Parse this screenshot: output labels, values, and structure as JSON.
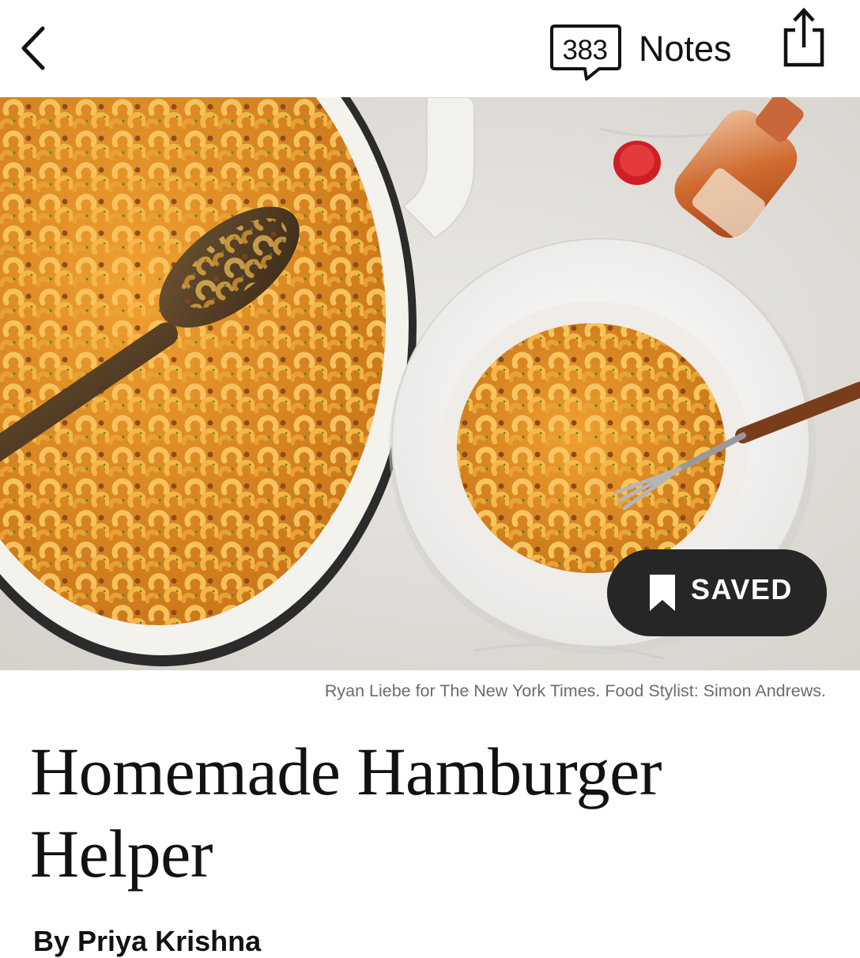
{
  "header": {
    "back_icon": "chevron-left-icon",
    "notes_count": "383",
    "notes_label": "Notes",
    "share_icon": "share-icon"
  },
  "hero": {
    "saved_label": "SAVED",
    "saved_icon": "bookmark-icon",
    "caption": "Ryan Liebe for The New York Times. Food Stylist: Simon Andrews."
  },
  "recipe": {
    "title": "Homemade Hamburger Helper",
    "byline_prefix": "By",
    "author": "Priya Krishna"
  },
  "colors": {
    "pill_background": "#262626",
    "text": "#121212",
    "caption": "#6b6b6b"
  }
}
